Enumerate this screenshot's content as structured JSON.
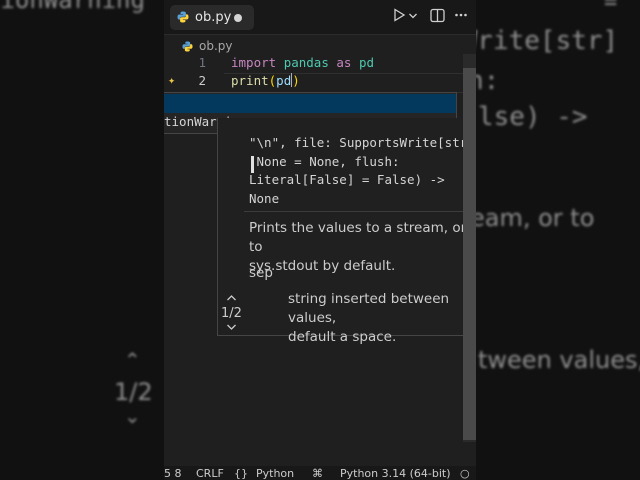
{
  "tab": {
    "filename": "ob.py"
  },
  "breadcrumb": {
    "filename": "ob.py"
  },
  "code": {
    "lines": [
      {
        "number": "1",
        "keyword1": "import",
        "module": "pandas",
        "keyword2": "as",
        "alias": "pd"
      },
      {
        "number": "2",
        "func": "print",
        "open_paren": "(",
        "arg": "pd",
        "close_paren": ")"
      }
    ]
  },
  "suggest": {
    "row2": "tionWarning"
  },
  "signature_help": {
    "signature_lines": "\"\\n\", file: SupportsWrite[str]\n None = None, flush:\nLiteral[False] = False) ->\nNone",
    "doc_line1": "Prints the values to a stream, or to",
    "doc_line2": "sys.stdout by default.",
    "param_name": "sep",
    "param_desc_line1": "string inserted between values,",
    "param_desc_line2": "default a space.",
    "overload_counter": "1/2"
  },
  "background": {
    "t1": "tionWarning",
    "t2": "sWrite[str]",
    "t3": "n:",
    "t4": "lse) ->",
    "t5": "eam, or to",
    "t6": "tween values,",
    "t7": "1/2",
    "t8": "="
  },
  "status": {
    "ln_col": "5 8",
    "eol": "CRLF",
    "lang": "Python",
    "interpreter": "Python 3.14 (64-bit)"
  },
  "colors": {
    "accent_selection": "#04395e",
    "keyword": "#c586c0",
    "module": "#4ec9b0"
  }
}
